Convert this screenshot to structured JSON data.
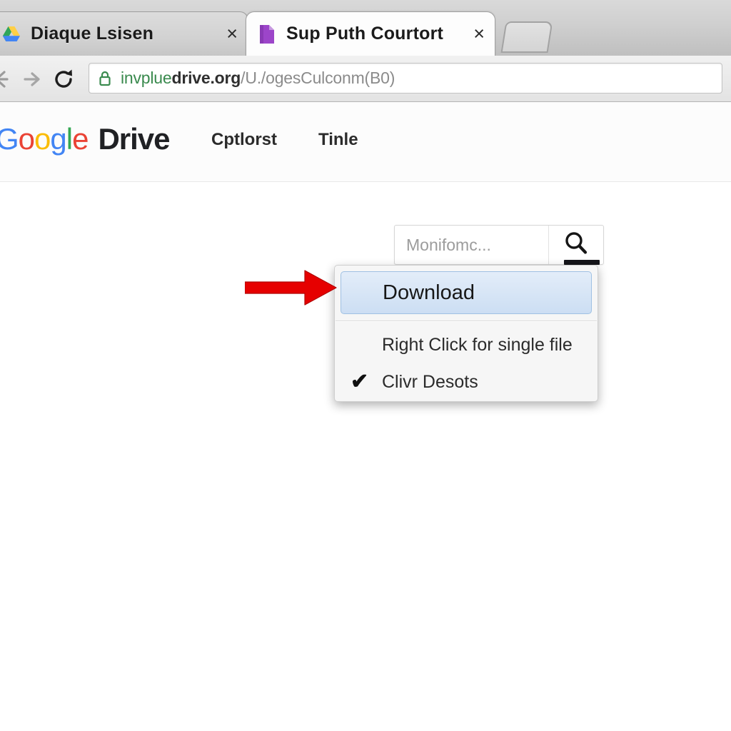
{
  "browser": {
    "tabs": [
      {
        "title": "Diaque Lsisen",
        "favicon": "google-drive-icon",
        "active": false,
        "close_label": "×"
      },
      {
        "title": "Sup Puth Courtort",
        "favicon": "purple-document-icon",
        "active": true,
        "close_label": "×"
      }
    ],
    "new_tab_label": "",
    "toolbar": {
      "back_icon": "back-arrow-icon",
      "forward_icon": "forward-arrow-icon",
      "reload_icon": "reload-icon"
    },
    "omnibox": {
      "lock_icon": "lock-icon",
      "url_secure_prefix": "invplue",
      "url_host": "drive.org",
      "url_path": "/U./ogesCulconm(B0)"
    }
  },
  "page": {
    "logo": {
      "g1": "G",
      "o1": "o",
      "o2": "o",
      "g2": "g",
      "l1": "l",
      "e1": "e",
      "word": "Drive"
    },
    "nav_links": [
      {
        "label": "Cptlorst"
      },
      {
        "label": "Tinle"
      }
    ],
    "search": {
      "placeholder": "Monifomc...",
      "icon": "search-icon"
    },
    "dropdown": {
      "items": [
        {
          "label": "Download",
          "highlighted": true,
          "checked": false
        },
        {
          "label": "Right Click for single file",
          "highlighted": false,
          "checked": false
        },
        {
          "label": "Clivr Desots",
          "highlighted": false,
          "checked": true,
          "check_glyph": "✔"
        }
      ]
    },
    "annotation": {
      "arrow_icon": "red-right-arrow-icon",
      "arrow_color": "#e60000",
      "points_at": "Download"
    }
  },
  "colors": {
    "google_blue": "#4285f4",
    "google_red": "#ea4335",
    "google_yellow": "#fbbc05",
    "google_green": "#34a853",
    "highlight_blue": "#ccdef3",
    "secure_green": "#3a8a4e",
    "arrow_red": "#e60000"
  }
}
